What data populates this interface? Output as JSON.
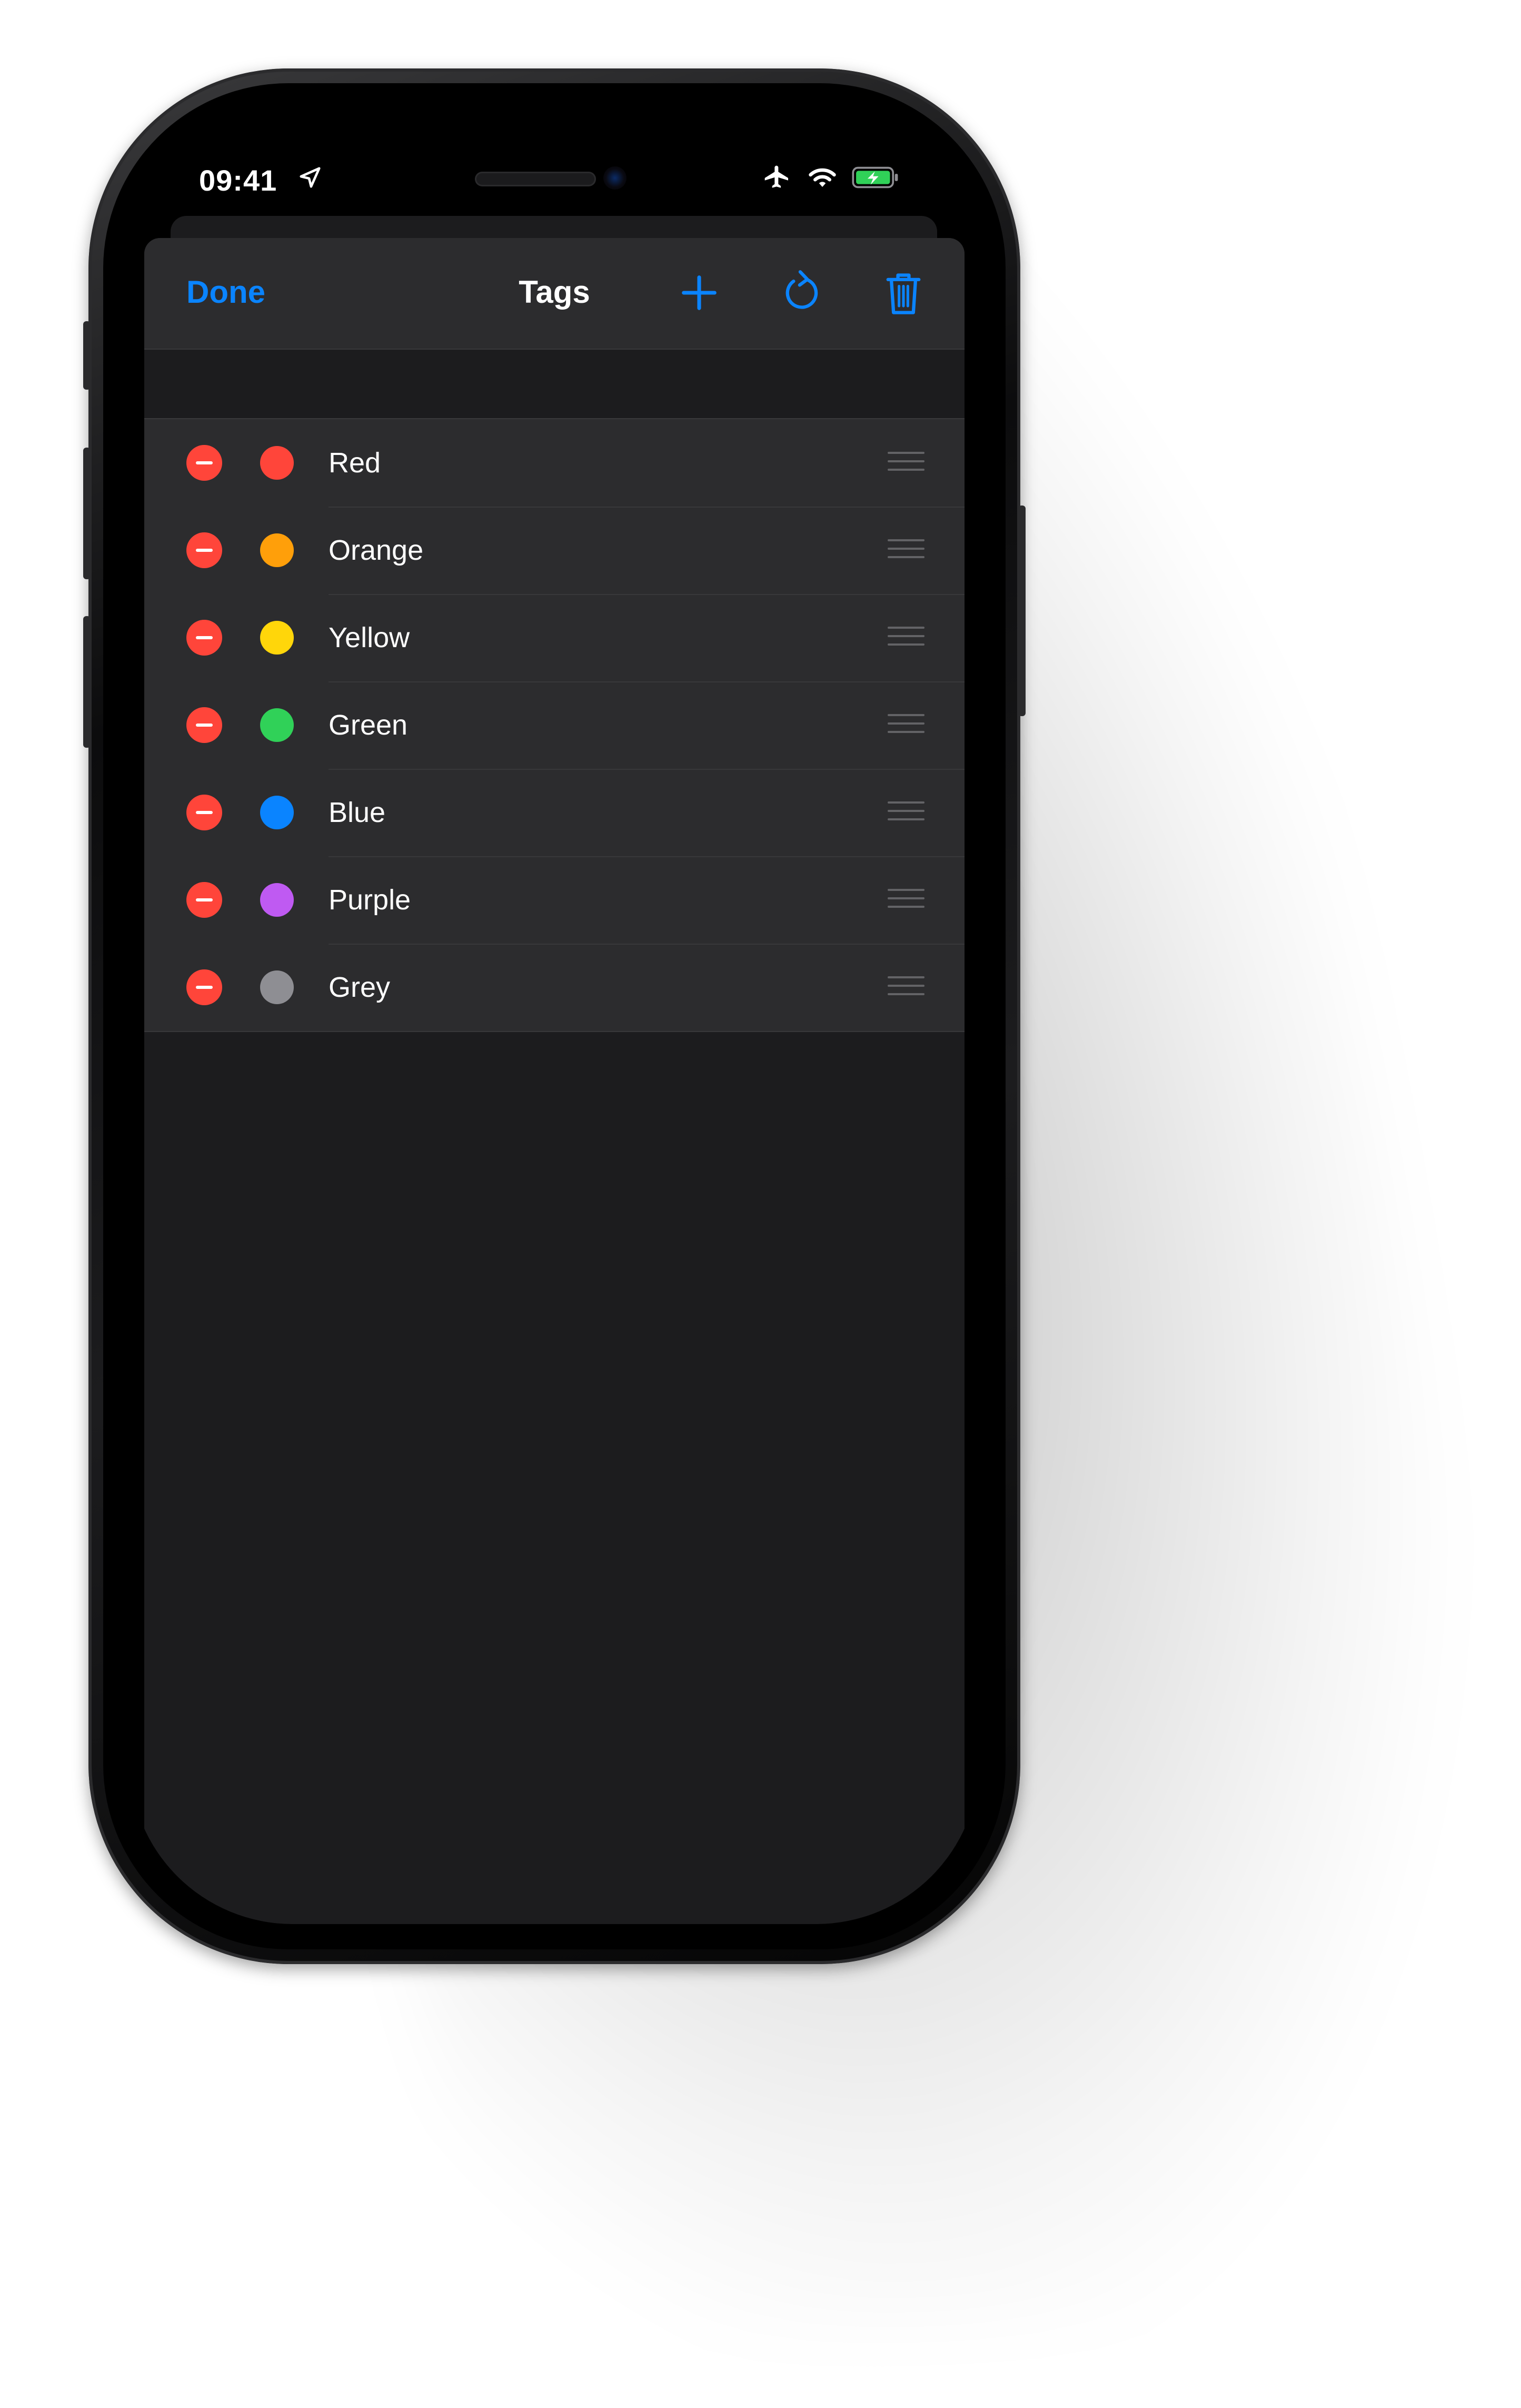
{
  "status_bar": {
    "time": "09:41",
    "icons": [
      "location-arrow-icon",
      "airplane-icon",
      "wifi-icon",
      "battery-charging-icon"
    ]
  },
  "navbar": {
    "done_label": "Done",
    "title": "Tags",
    "actions": [
      "plus-icon",
      "refresh-icon",
      "trash-icon"
    ]
  },
  "colors": {
    "accent": "#0a84ff",
    "delete": "#ff453a",
    "background": "#1c1c1e",
    "row": "#2c2c2e"
  },
  "tags": [
    {
      "label": "Red",
      "color": "#ff453a"
    },
    {
      "label": "Orange",
      "color": "#ff9f0a"
    },
    {
      "label": "Yellow",
      "color": "#ffd60a"
    },
    {
      "label": "Green",
      "color": "#30d158"
    },
    {
      "label": "Blue",
      "color": "#0a84ff"
    },
    {
      "label": "Purple",
      "color": "#bf5af2"
    },
    {
      "label": "Grey",
      "color": "#8e8e93"
    }
  ]
}
